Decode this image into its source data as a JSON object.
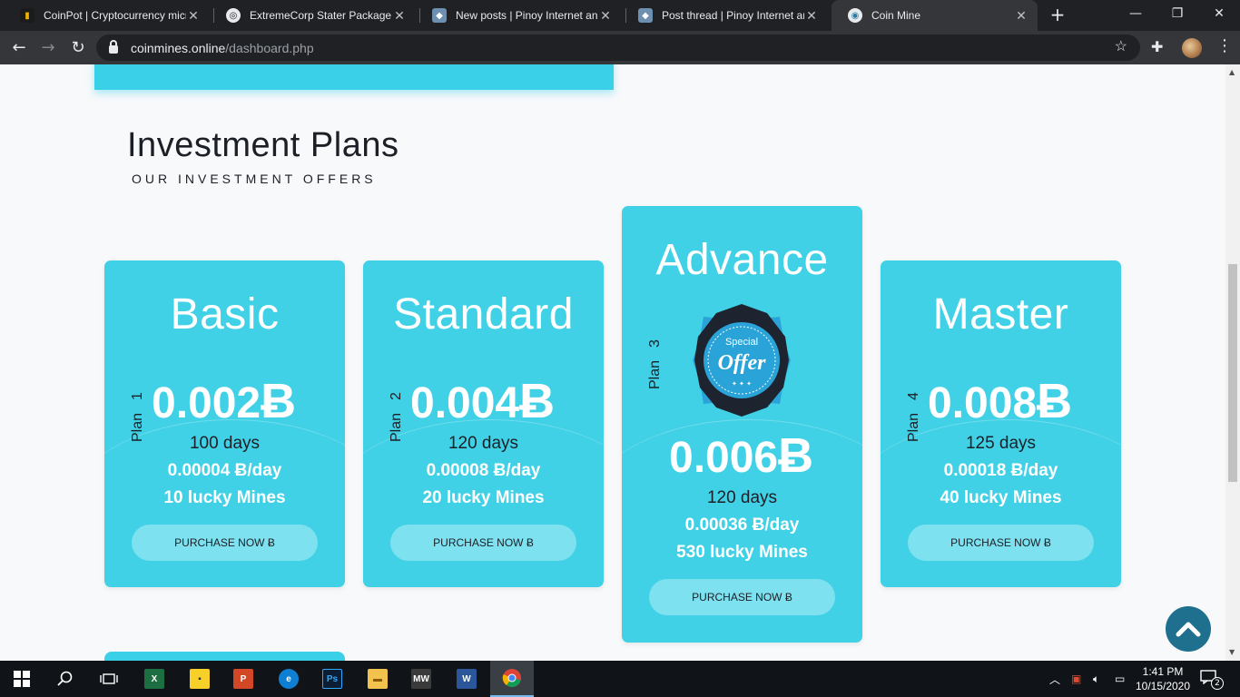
{
  "browser": {
    "tabs": [
      {
        "title": "CoinPot | Cryptocurrency micr",
        "favicon": "coinpot-icon",
        "active": false
      },
      {
        "title": "ExtremeCorp Stater Package -",
        "favicon": "extremecorp-icon",
        "active": false
      },
      {
        "title": "New posts | Pinoy Internet and",
        "favicon": "pinoy-forum-icon",
        "active": false
      },
      {
        "title": "Post thread | Pinoy Internet an",
        "favicon": "pinoy-forum-icon",
        "active": false
      },
      {
        "title": "Coin Mine",
        "favicon": "coin-mine-icon",
        "active": true
      }
    ],
    "url_host": "coinmines.online",
    "url_path": "/dashboard.php"
  },
  "page": {
    "section_title": "Investment Plans",
    "section_subtitle": "OUR INVESTMENT OFFERS",
    "plans": [
      {
        "name": "Basic",
        "plan_label": "Plan",
        "plan_number": "1",
        "price": "0.002",
        "currency": "Ƀ",
        "days": "100 days",
        "daily": "0.00004 Ƀ/day",
        "mines": "10 lucky Mines",
        "button": "PURCHASE NOW Ƀ"
      },
      {
        "name": "Standard",
        "plan_label": "Plan",
        "plan_number": "2",
        "price": "0.004",
        "currency": "Ƀ",
        "days": "120 days",
        "daily": "0.00008 Ƀ/day",
        "mines": "20 lucky Mines",
        "button": "PURCHASE NOW Ƀ"
      },
      {
        "name": "Advance",
        "plan_label": "Plan",
        "plan_number": "3",
        "price": "0.006",
        "currency": "Ƀ",
        "days": "120 days",
        "daily": "0.00036 Ƀ/day",
        "mines": "530 lucky Mines",
        "button": "PURCHASE NOW Ƀ",
        "badge_top": "Special",
        "badge_main": "Offer",
        "badge_stars": "✦ ✦ ✦"
      },
      {
        "name": "Master",
        "plan_label": "Plan",
        "plan_number": "4",
        "price": "0.008",
        "currency": "Ƀ",
        "days": "125 days",
        "daily": "0.00018 Ƀ/day",
        "mines": "40 lucky Mines",
        "button": "PURCHASE NOW Ƀ"
      }
    ]
  },
  "taskbar": {
    "apps": [
      "windows-start",
      "search",
      "task-view",
      "excel",
      "sticky-notes",
      "powerpoint",
      "edge",
      "photoshop",
      "file-explorer",
      "game-app",
      "word",
      "chrome"
    ],
    "time": "1:41 PM",
    "date": "10/15/2020",
    "notification_count": "2"
  },
  "colors": {
    "card": "#41d1e6",
    "button": "#7de1ef",
    "scroll_top": "#1f6f8e",
    "text_dark": "#1c1f26"
  }
}
